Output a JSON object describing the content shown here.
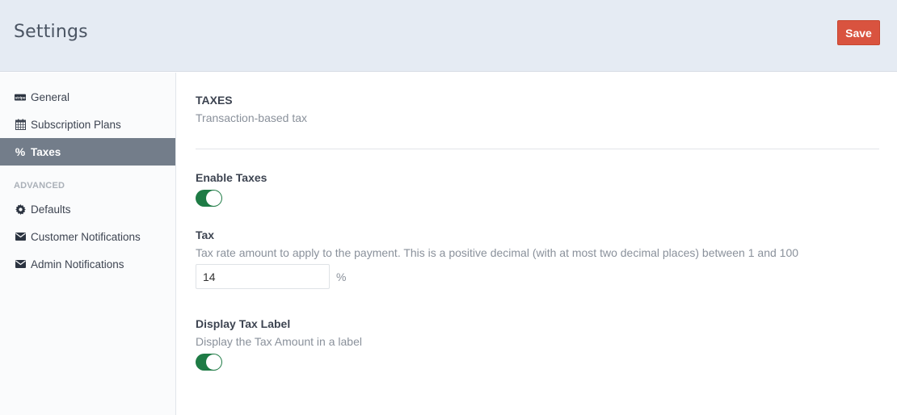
{
  "header": {
    "title": "Settings",
    "save_label": "Save",
    "save_color": "#d9533f"
  },
  "sidebar": {
    "items": [
      {
        "label": "General",
        "icon": "stripe-icon",
        "active": false
      },
      {
        "label": "Subscription Plans",
        "icon": "calendar-icon",
        "active": false
      },
      {
        "label": "Taxes",
        "icon": "percent-icon",
        "active": true
      }
    ],
    "advanced_heading": "ADVANCED",
    "advanced_items": [
      {
        "label": "Defaults",
        "icon": "gear-icon"
      },
      {
        "label": "Customer Notifications",
        "icon": "envelope-icon"
      },
      {
        "label": "Admin Notifications",
        "icon": "envelope-icon"
      }
    ]
  },
  "main": {
    "section_title": "TAXES",
    "section_subtitle": "Transaction-based tax",
    "enable_taxes": {
      "label": "Enable Taxes",
      "enabled": true
    },
    "tax": {
      "label": "Tax",
      "help": "Tax rate amount to apply to the payment. This is a positive decimal (with at most two decimal places) between 1 and 100",
      "value": "14",
      "unit": "%"
    },
    "display_tax_label": {
      "label": "Display Tax Label",
      "help": "Display the Tax Amount in a label",
      "enabled": true
    },
    "toggle_on_color": "#1e7b45"
  }
}
